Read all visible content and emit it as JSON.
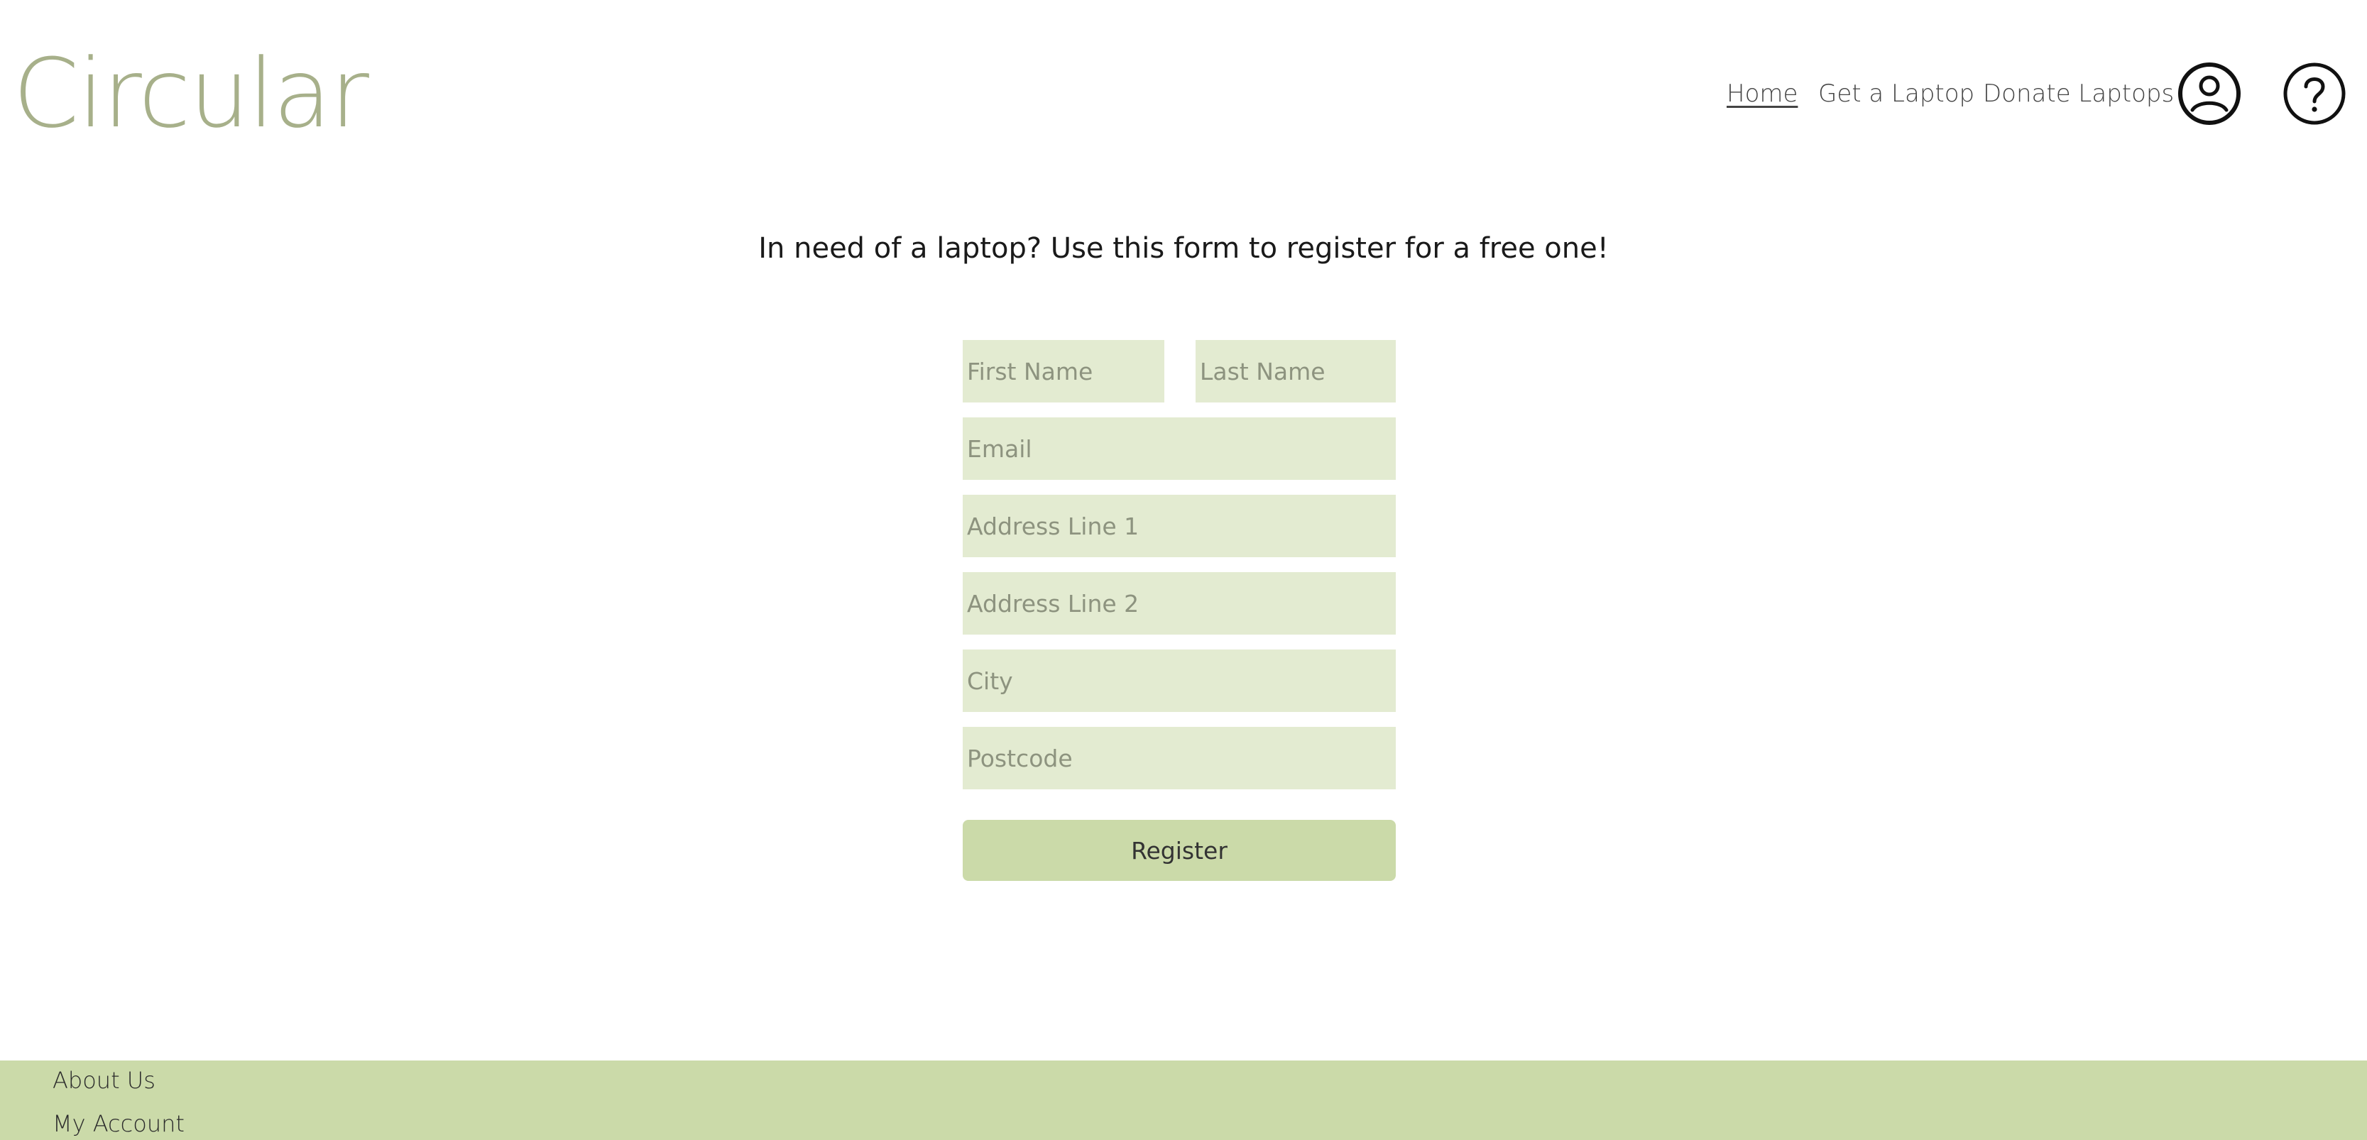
{
  "brand": {
    "logo_text": "Circular",
    "logo_color": "#a7b08a"
  },
  "nav": {
    "home": "Home",
    "get_laptop": "Get a Laptop",
    "donate_laptops": "Donate Laptops",
    "account_icon": "account-icon",
    "help_icon": "help-icon"
  },
  "form": {
    "intro": "In need of a laptop? Use this form to register for a free one!",
    "first_name_placeholder": "First Name",
    "last_name_placeholder": "Last Name",
    "email_placeholder": "Email",
    "address1_placeholder": "Address Line 1",
    "address2_placeholder": "Address Line 2",
    "city_placeholder": "City",
    "postcode_placeholder": "Postcode",
    "register_label": "Register"
  },
  "footer": {
    "about_us": "About Us",
    "my_account": "My Account"
  },
  "colors": {
    "input_background": "#e3ebd1",
    "accent_green": "#cbdaa9",
    "text": "#1a1a1a"
  }
}
